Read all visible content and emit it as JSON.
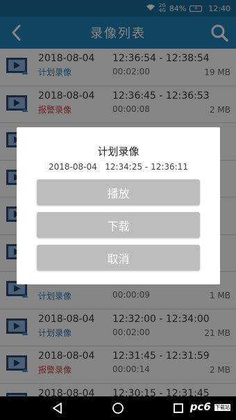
{
  "status_bar": {
    "signal": "2G 4G",
    "battery": "84%",
    "time": "12:40"
  },
  "header": {
    "title": "录像列表"
  },
  "recordings": [
    {
      "date": "2018-08-04",
      "time_range": "12:36:54 - 12:38:54",
      "type": "计划录像",
      "type_kind": "plan",
      "duration": "00:02:00",
      "size": "19 MB"
    },
    {
      "date": "2018-08-04",
      "time_range": "12:36:45 - 12:36:53",
      "type": "报警录像",
      "type_kind": "alarm",
      "duration": "00:00:08",
      "size": "2 MB"
    },
    {
      "date": "",
      "time_range": "",
      "type": "",
      "type_kind": "plan",
      "duration": "",
      "size": ""
    },
    {
      "date": "",
      "time_range": "",
      "type": "",
      "type_kind": "plan",
      "duration": "",
      "size": ""
    },
    {
      "date": "",
      "time_range": "",
      "type": "",
      "type_kind": "plan",
      "duration": "",
      "size": ""
    },
    {
      "date": "",
      "time_range": "",
      "type": "",
      "type_kind": "plan",
      "duration": "",
      "size": ""
    },
    {
      "date": "",
      "time_range": "",
      "type": "计划录像",
      "type_kind": "plan",
      "duration": "00:00:09",
      "size": "1 MB"
    },
    {
      "date": "2018-08-04",
      "time_range": "12:32:00 - 12:34:00",
      "type": "计划录像",
      "type_kind": "plan",
      "duration": "00:02:00",
      "size": "21 MB"
    },
    {
      "date": "2018-08-04",
      "time_range": "12:31:45 - 12:31:59",
      "type": "报警录像",
      "type_kind": "alarm",
      "duration": "00:00:14",
      "size": "2 MB"
    },
    {
      "date": "2018-08-04",
      "time_range": "12:30:15 - 12:31:45",
      "type": "",
      "type_kind": "plan",
      "duration": "",
      "size": ""
    }
  ],
  "dialog": {
    "title": "计划录像",
    "info": "2018-08-04   12:34:25 - 12:36:11",
    "play_label": "播放",
    "download_label": "下载",
    "cancel_label": "取消"
  },
  "watermark": {
    "text": "pc6",
    "badge": "下载站"
  },
  "colors": {
    "accent": "#2182b8",
    "plan": "#2a7cc0",
    "alarm": "#d0453e"
  }
}
